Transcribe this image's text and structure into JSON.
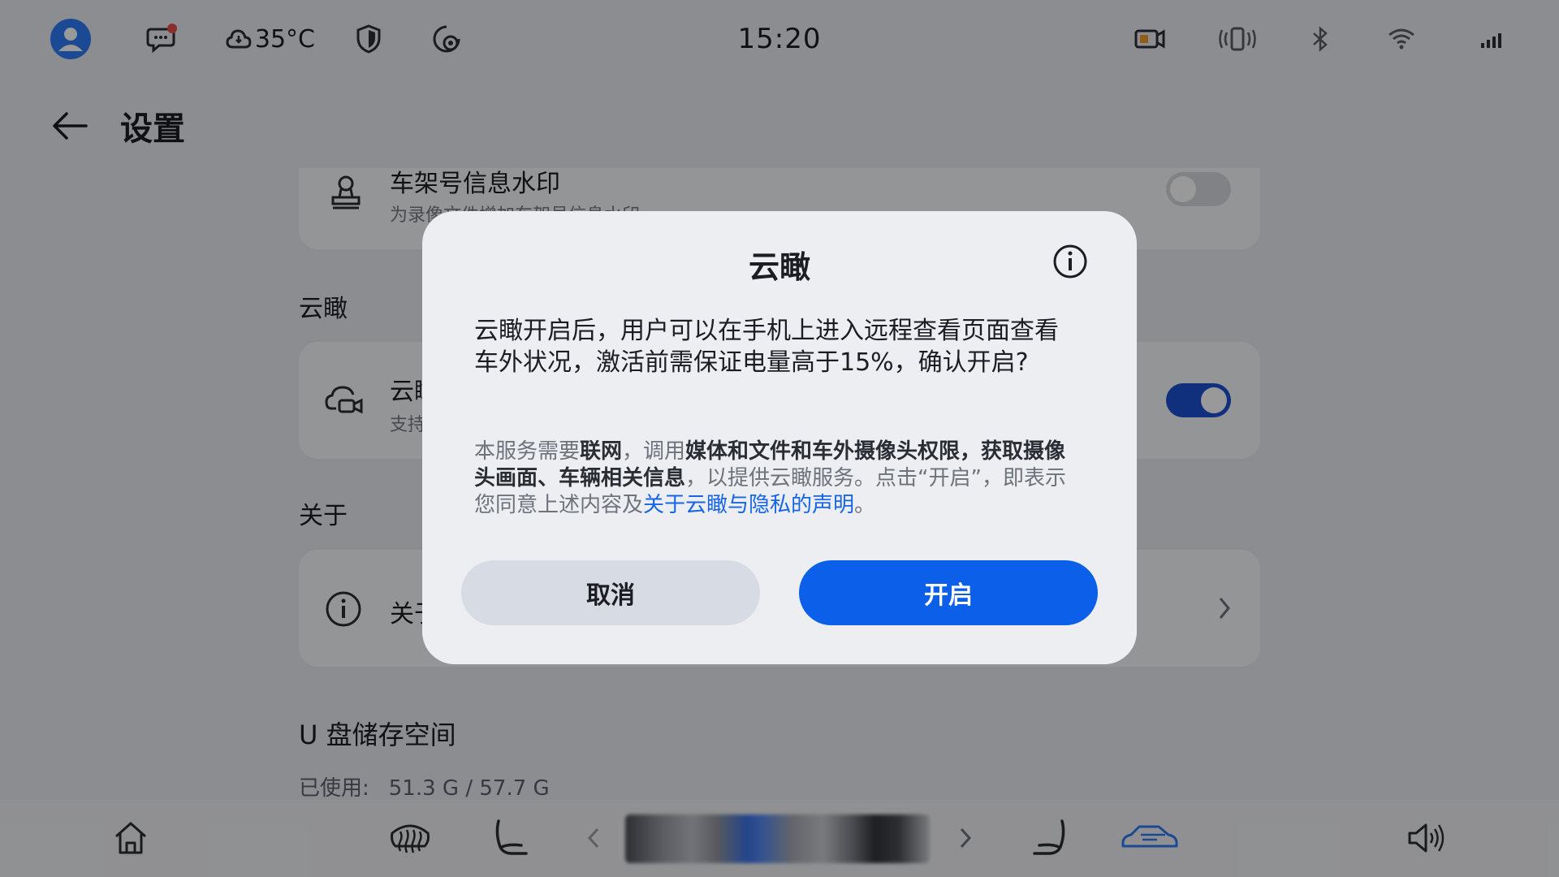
{
  "status_bar": {
    "temperature": "35°C",
    "clock": "15:20",
    "icons": [
      "avatar",
      "message-icon",
      "cloud-icon",
      "shield-icon",
      "camera-settings-icon",
      "dashcam-icon",
      "vibrate-icon",
      "bluetooth-icon",
      "wifi-icon",
      "signal-icon"
    ]
  },
  "header": {
    "title": "设置"
  },
  "settings": {
    "watermark": {
      "title": "车架号信息水印",
      "subtitle": "为录像文件增加车架号信息水印",
      "enabled": false
    },
    "cloud_section_title": "云瞰",
    "cloud_row": {
      "title": "云瞰",
      "subtitle": "支持",
      "enabled": true
    },
    "about_section_title": "关于",
    "about_row": {
      "title": "关于"
    },
    "storage": {
      "title": "U 盘储存空间",
      "used_label": "已使用:",
      "used_value": "51.3 G / 57.7 G"
    }
  },
  "dialog": {
    "title": "云瞰",
    "question": "云瞰开启后，用户可以在手机上进入远程查看页面查看车外状况，激活前需保证电量高于15%，确认开启?",
    "note_parts": {
      "p1": "本服务需要",
      "b1": "联网",
      "p2": "，调用",
      "b2": "媒体和文件和车外摄像头权限，获取摄像头画面、车辆相关信息",
      "p3": "，以提供云瞰服务。点击“开启”，即表示您同意上述内容及",
      "link": "关于云瞰与隐私的声明",
      "p4": "。"
    },
    "cancel_label": "取消",
    "confirm_label": "开启"
  },
  "colors": {
    "accent": "#0b5fe8",
    "link": "#1565e6",
    "avatar": "#2f7bf6",
    "toggle_on": "#1c4fd1",
    "toggle_off": "#d6d9df",
    "cancel_button": "#d7dbe4"
  }
}
